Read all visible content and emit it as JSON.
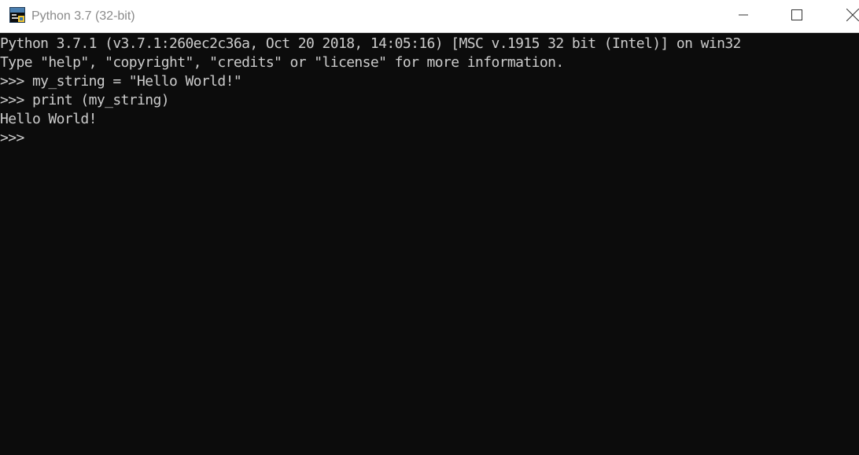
{
  "window": {
    "title": "Python 3.7 (32-bit)",
    "icon": "python-icon",
    "controls": {
      "minimize": "minimize-icon",
      "maximize": "maximize-icon",
      "close": "close-icon"
    }
  },
  "console": {
    "background": "#0c0c0c",
    "foreground": "#cccccc",
    "lines": [
      "Python 3.7.1 (v3.7.1:260ec2c36a, Oct 20 2018, 14:05:16) [MSC v.1915 32 bit (Intel)] on win32",
      "Type \"help\", \"copyright\", \"credits\" or \"license\" for more information.",
      ">>> my_string = \"Hello World!\"",
      ">>> print (my_string)",
      "Hello World!",
      ">>> "
    ]
  }
}
